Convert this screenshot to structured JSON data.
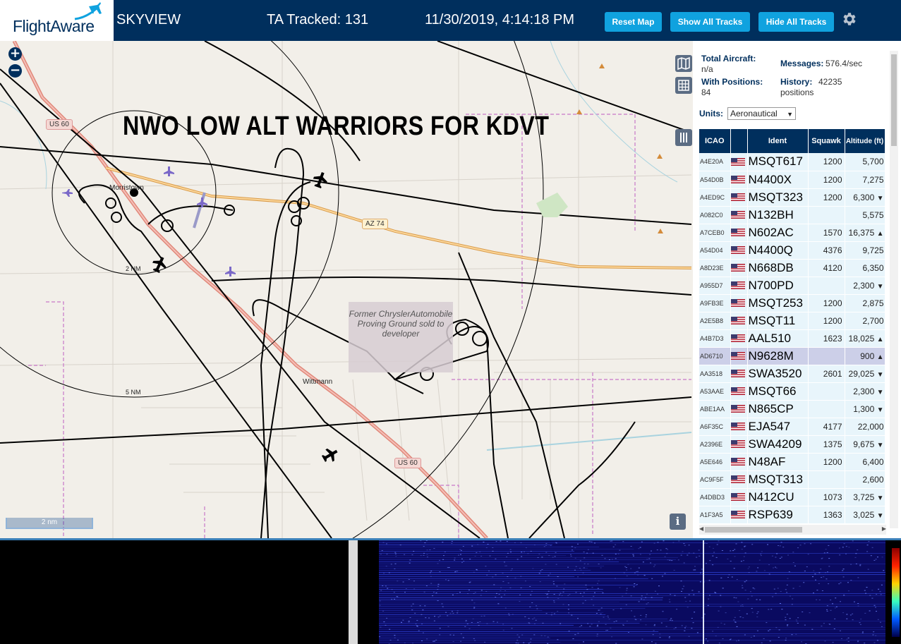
{
  "header": {
    "logo_text": "FlightAware",
    "app_title": "SKYVIEW",
    "ta_tracked": "TA Tracked: 131",
    "datetime": "11/30/2019, 4:14:18 PM",
    "buttons": {
      "reset_map": "Reset Map",
      "show_all_tracks": "Show All Tracks",
      "hide_all_tracks": "Hide All Tracks"
    },
    "settings_icon": "gear-icon"
  },
  "map": {
    "overlay_title": "NWO LOW ALT WARRIORS FOR KDVT",
    "zoom_in": "+",
    "zoom_out": "−",
    "scale_label": "2 nm",
    "info_label": "i",
    "range_ring_labels": [
      "2 NM",
      "5 NM"
    ],
    "place_labels": [
      "Morristown",
      "Wittmann"
    ],
    "road_shields": [
      "US 60",
      "AZ 74",
      "US 60"
    ],
    "proving_ground_label": "Former ChryslerAutomobile Proving Ground sold to developer",
    "colors": {
      "land": "#f2efe9",
      "tracks": "#000000",
      "highway": "#e0887a",
      "az74": "#f0b46a",
      "boundary": "#c877c8",
      "water": "#a9d3df"
    }
  },
  "sidebar": {
    "stats": {
      "total_aircraft_label": "Total Aircraft:",
      "total_aircraft_value": "n/a",
      "with_positions_label": "With Positions:",
      "with_positions_value": "84",
      "messages_label": "Messages:",
      "messages_value": "576.4/sec",
      "history_label": "History:",
      "history_value": "42235",
      "history_unit": "positions"
    },
    "units_label": "Units:",
    "units_value": "Aeronautical",
    "columns": [
      "ICAO",
      "",
      "Ident",
      "Squawk",
      "Altitude (ft)"
    ],
    "rows": [
      {
        "icao": "A4E20A",
        "ident": "MSQT617",
        "squawk": "1200",
        "alt": "5,700",
        "trend": ""
      },
      {
        "icao": "A54D0B",
        "ident": "N4400X",
        "squawk": "1200",
        "alt": "7,275",
        "trend": ""
      },
      {
        "icao": "A4ED9C",
        "ident": "MSQT323",
        "squawk": "1200",
        "alt": "6,300",
        "trend": "▼"
      },
      {
        "icao": "A082C0",
        "ident": "N132BH",
        "squawk": "",
        "alt": "5,575",
        "trend": ""
      },
      {
        "icao": "A7CEB0",
        "ident": "N602AC",
        "squawk": "1570",
        "alt": "16,375",
        "trend": "▲"
      },
      {
        "icao": "A54D04",
        "ident": "N4400Q",
        "squawk": "4376",
        "alt": "9,725",
        "trend": ""
      },
      {
        "icao": "A8D23E",
        "ident": "N668DB",
        "squawk": "4120",
        "alt": "6,350",
        "trend": ""
      },
      {
        "icao": "A955D7",
        "ident": "N700PD",
        "squawk": "",
        "alt": "2,300",
        "trend": "▼"
      },
      {
        "icao": "A9FB3E",
        "ident": "MSQT253",
        "squawk": "1200",
        "alt": "2,875",
        "trend": ""
      },
      {
        "icao": "A2E5B8",
        "ident": "MSQT11",
        "squawk": "1200",
        "alt": "2,700",
        "trend": ""
      },
      {
        "icao": "A4B7D3",
        "ident": "AAL510",
        "squawk": "1623",
        "alt": "18,025",
        "trend": "▲"
      },
      {
        "icao": "AD6710",
        "ident": "N9628M",
        "squawk": "",
        "alt": "900",
        "trend": "▲",
        "selected": true
      },
      {
        "icao": "AA3518",
        "ident": "SWA3520",
        "squawk": "2601",
        "alt": "29,025",
        "trend": "▼"
      },
      {
        "icao": "A53AAE",
        "ident": "MSQT66",
        "squawk": "",
        "alt": "2,300",
        "trend": "▼"
      },
      {
        "icao": "ABE1AA",
        "ident": "N865CP",
        "squawk": "",
        "alt": "1,300",
        "trend": "▼"
      },
      {
        "icao": "A6F35C",
        "ident": "EJA547",
        "squawk": "4177",
        "alt": "22,000",
        "trend": ""
      },
      {
        "icao": "A2396E",
        "ident": "SWA4209",
        "squawk": "1375",
        "alt": "9,675",
        "trend": "▼"
      },
      {
        "icao": "A5E646",
        "ident": "N48AF",
        "squawk": "1200",
        "alt": "6,400",
        "trend": ""
      },
      {
        "icao": "AC9F5F",
        "ident": "MSQT313",
        "squawk": "",
        "alt": "2,600",
        "trend": ""
      },
      {
        "icao": "A4DBD3",
        "ident": "N412CU",
        "squawk": "1073",
        "alt": "3,725",
        "trend": "▼"
      },
      {
        "icao": "A1F3A5",
        "ident": "RSP639",
        "squawk": "1363",
        "alt": "3,025",
        "trend": "▼"
      }
    ]
  },
  "waterfall": {
    "colors": {
      "background": "#0a0a60",
      "bright": "#3b55ff",
      "splitter": "#dcdcdc"
    }
  }
}
